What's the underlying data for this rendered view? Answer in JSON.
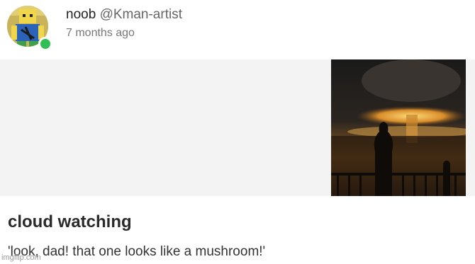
{
  "post": {
    "author": {
      "name": "noob",
      "handle": "@Kman-artist",
      "time_ago": "7 months ago",
      "online_color": "#2fbf55"
    },
    "media": {
      "description_icon": "image-icon"
    },
    "title": "cloud watching",
    "body": "'look, dad! that one looks like a mushroom!'"
  },
  "watermark": "imgflip.com"
}
